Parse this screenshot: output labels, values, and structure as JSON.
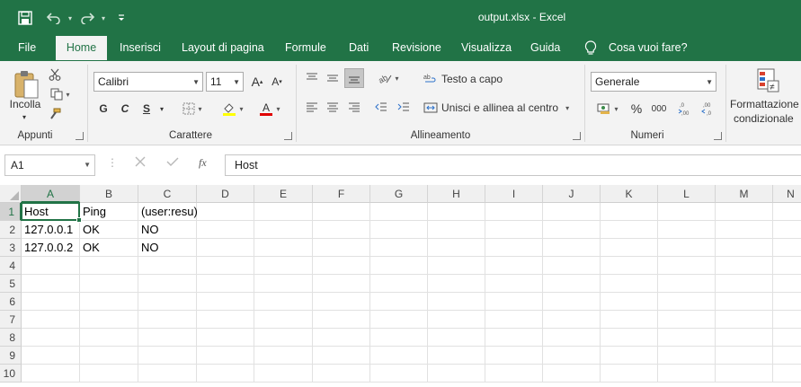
{
  "window": {
    "title": "output.xlsx  -  Excel"
  },
  "tabs": [
    "File",
    "Home",
    "Inserisci",
    "Layout di pagina",
    "Formule",
    "Dati",
    "Revisione",
    "Visualizza",
    "Guida"
  ],
  "active_tab": "Home",
  "tell_me": "Cosa vuoi fare?",
  "ribbon": {
    "clipboard": {
      "label": "Appunti",
      "paste": "Incolla"
    },
    "font": {
      "label": "Carattere",
      "name": "Calibri",
      "size": "11",
      "bold": "G",
      "italic": "C",
      "underline": "S"
    },
    "alignment": {
      "label": "Allineamento",
      "wrap": "Testo a capo",
      "merge": "Unisci e allinea al centro"
    },
    "number": {
      "label": "Numeri",
      "format": "Generale",
      "percent": "%",
      "thousands": "000",
      "inc_decimal": ",0\n,00",
      "dec_decimal": ",00\n,0"
    },
    "styles": {
      "conditional_line1": "Formattazione",
      "conditional_line2": "condizionale"
    }
  },
  "formula_bar": {
    "name_box": "A1",
    "fx": "fx",
    "value": "Host"
  },
  "columns": [
    "A",
    "B",
    "C",
    "D",
    "E",
    "F",
    "G",
    "H",
    "I",
    "J",
    "K",
    "L",
    "M",
    "N"
  ],
  "rows": [
    "1",
    "2",
    "3",
    "4",
    "5",
    "6",
    "7",
    "8",
    "9",
    "10"
  ],
  "cells": [
    [
      "Host",
      "Ping",
      "(user:resu)"
    ],
    [
      "127.0.0.1",
      "OK",
      "NO"
    ],
    [
      "127.0.0.2",
      "OK",
      "NO"
    ]
  ],
  "colors": {
    "brand": "#217346",
    "ribbon_bg": "#f3f3f3"
  }
}
